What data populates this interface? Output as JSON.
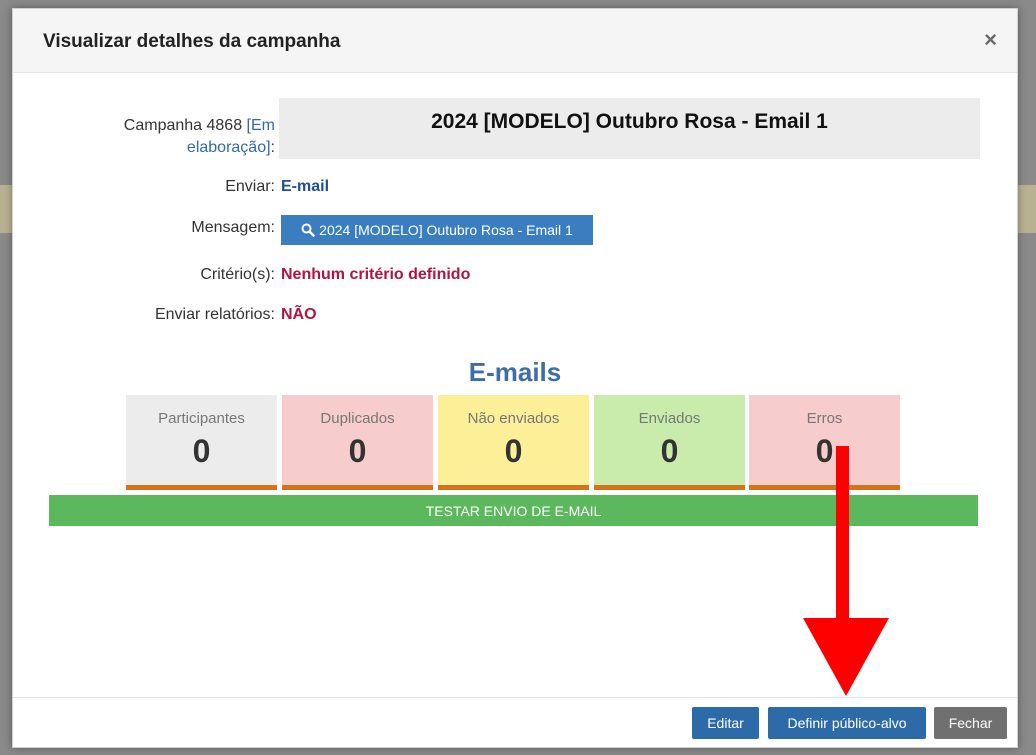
{
  "modal": {
    "title": "Visualizar detalhes da campanha",
    "close_icon": "close-icon",
    "close_glyph": "×"
  },
  "campaign": {
    "label_prefix": "Campanha 4868",
    "status_link_line1": "[Em",
    "status_link_line2": "elaboração]",
    "label_suffix": ":",
    "name": "2024 [MODELO] Outubro Rosa - Email 1"
  },
  "fields": {
    "send_label": "Enviar:",
    "send_value": "E-mail",
    "message_label": "Mensagem:",
    "message_button": "2024 [MODELO] Outubro Rosa - Email 1",
    "message_icon": "search-icon",
    "criteria_label": "Critério(s):",
    "criteria_value": "Nenhum critério definido",
    "reports_label": "Enviar relatórios:",
    "reports_value": "NÃO"
  },
  "emails": {
    "title": "E-mails",
    "stats": [
      {
        "label": "Participantes",
        "value": "0",
        "color": "#ececec"
      },
      {
        "label": "Duplicados",
        "value": "0",
        "color": "#f7cccc"
      },
      {
        "label": "Não enviados",
        "value": "0",
        "color": "#fbef97"
      },
      {
        "label": "Enviados",
        "value": "0",
        "color": "#c9ecad"
      },
      {
        "label": "Erros",
        "value": "0",
        "color": "#f7cccc"
      }
    ],
    "test_button": "TESTAR ENVIO DE E-MAIL"
  },
  "footer": {
    "edit": "Editar",
    "define_audience": "Definir público-alvo",
    "close": "Fechar"
  },
  "annotation": {
    "icon": "arrow-down-icon",
    "color": "#ff0000"
  }
}
